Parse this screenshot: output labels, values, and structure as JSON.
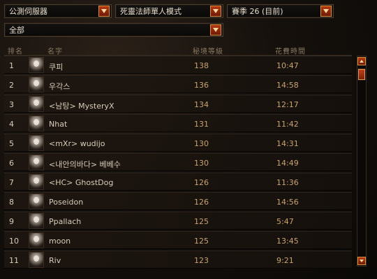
{
  "filters": {
    "server": "公測伺服器",
    "mode": "死靈法師單人模式",
    "season": "賽季 26 (目前)",
    "region": "全部"
  },
  "table": {
    "headers": [
      "排名",
      "名字",
      "秘境等級",
      "花費時間"
    ],
    "rows": [
      {
        "rank": "1",
        "name": "쿠피",
        "level": "138",
        "time": "10:47"
      },
      {
        "rank": "2",
        "name": "우각스",
        "level": "136",
        "time": "14:58"
      },
      {
        "rank": "3",
        "name": "<남탕> MysteryX",
        "level": "134",
        "time": "12:17"
      },
      {
        "rank": "4",
        "name": "Nhat",
        "level": "131",
        "time": "11:42"
      },
      {
        "rank": "5",
        "name": "<mXr> wudijo",
        "level": "130",
        "time": "14:31"
      },
      {
        "rank": "6",
        "name": "<내안의바다> 베베수",
        "level": "130",
        "time": "14:49"
      },
      {
        "rank": "7",
        "name": "<HC> GhostDog",
        "level": "126",
        "time": "11:36"
      },
      {
        "rank": "8",
        "name": "Poseidon",
        "level": "126",
        "time": "14:56"
      },
      {
        "rank": "9",
        "name": "Ppallach",
        "level": "125",
        "time": "5:47"
      },
      {
        "rank": "10",
        "name": "moon",
        "level": "125",
        "time": "13:45"
      },
      {
        "rank": "11",
        "name": "Riv",
        "level": "123",
        "time": "9:21"
      }
    ]
  },
  "icons": {
    "dropdown": "chevron-down-icon",
    "portrait": "necromancer-portrait-icon",
    "scroll_up": "arrow-up-icon",
    "scroll_down": "arrow-down-icon"
  },
  "colors": {
    "accent": "#b33a14",
    "text": "#d8cdb9",
    "value": "#c9a46a"
  }
}
